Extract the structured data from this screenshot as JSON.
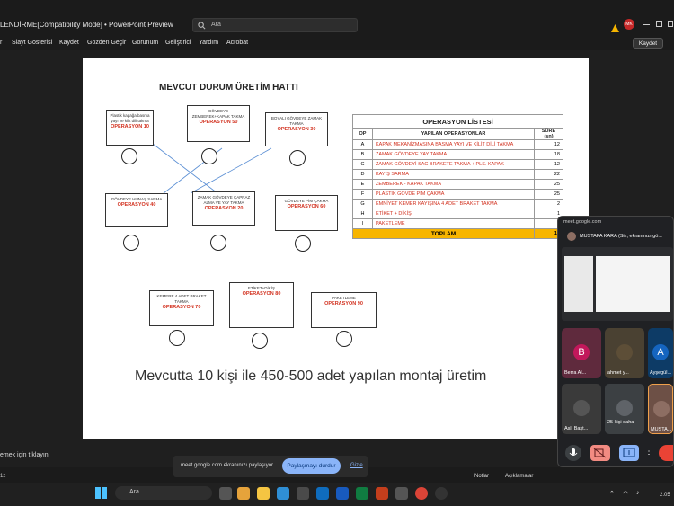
{
  "app": {
    "title": "LENDİRME[Compatibility Mode]  •  PowerPoint Preview",
    "search_placeholder": "Ara",
    "user_initials": "MK",
    "save_button": "Kaydet",
    "menu": [
      "r",
      "Slayt Gösterisi",
      "Kaydet",
      "Gözden Geçir",
      "Görünüm",
      "Geliştirici",
      "Yardım",
      "Acrobat"
    ]
  },
  "slide": {
    "title": "MEVCUT DURUM ÜRETİM HATTI",
    "stations": [
      {
        "desc": "Plastik kapağa basma yayı ve kilit dili takma",
        "op": "OPERASYON 10"
      },
      {
        "desc": "GÖVDEYE ZEMBEREK+KAPAK TAKMA",
        "op": "OPERASYON 50"
      },
      {
        "desc": "BOYALI GÖVDEYE ZAMAK TAKMA",
        "op": "OPERASYON 30"
      },
      {
        "desc": "GÖVDEYE HUNAŞ SARMA",
        "op": "OPERASYON 40"
      },
      {
        "desc": "ZAMAK GÖVDEYE ÇAPRAZ ALMA VE YAY TAKMA",
        "op": "OPERASYON 20"
      },
      {
        "desc": "GÖVDEYE PİM ÇAKMA",
        "op": "OPERASYON 60"
      },
      {
        "desc": "KEMERE 4 ADET BRAKET TAKMA",
        "op": "OPERASYON 70"
      },
      {
        "desc": "ETİKET+DİKİŞ",
        "op": "OPERASYON 80"
      },
      {
        "desc": "PAKETLEME",
        "op": "OPERASYON 90"
      }
    ],
    "table": {
      "title": "OPERASYON LİSTESİ",
      "headers": [
        "OP",
        "YAPILAN OPERASYONLAR",
        "SÜRE (sn)"
      ],
      "rows": [
        {
          "op": "A",
          "name": "KAPAK MEKANİZMASINA BASMA YAYI VE KİLİT DİLİ TAKMA",
          "sure": "12"
        },
        {
          "op": "B",
          "name": "ZAMAK GÖVDEYE YAY TAKMA",
          "sure": "18"
        },
        {
          "op": "C",
          "name": "ZAMAK GÖVDEYİ SAC BRAKETE TAKMA + PLS. KAPAK",
          "sure": "12"
        },
        {
          "op": "D",
          "name": "KAYIŞ SARMA",
          "sure": "22"
        },
        {
          "op": "E",
          "name": "ZEMBEREK - KAPAK TAKMA",
          "sure": "25"
        },
        {
          "op": "F",
          "name": "PLASTİK GÖVDE PİM ÇAKMA",
          "sure": "25"
        },
        {
          "op": "G",
          "name": "EMNİYET KEMER KAYIŞINA 4 ADET BRAKET TAKMA",
          "sure": "2"
        },
        {
          "op": "H",
          "name": "ETİKET + DİKİŞ",
          "sure": "1"
        },
        {
          "op": "I",
          "name": "PAKETLEME",
          "sure": "1"
        }
      ],
      "total_label": "TOPLAM",
      "total_value": "17"
    },
    "footer": "Mevcutta 10 kişi ile 450-500  adet yapılan montaj üretim"
  },
  "meet": {
    "url": "meet.google.com",
    "presenter": "MUSTAFA KARA (Siz, ekranınızı gö...",
    "participants": [
      {
        "initial": "B",
        "name": "Berra Al...",
        "color": "#c2185b"
      },
      {
        "initial": "",
        "name": "ahmet y...",
        "color": "#5d4e37"
      },
      {
        "initial": "A",
        "name": "Ayşegül...",
        "color": "#1565c0"
      },
      {
        "initial": "",
        "name": "Aslı Başt...",
        "color": "#3d3d3d"
      },
      {
        "initial": "",
        "name": "25 kişi daha",
        "color": "#3c4043"
      },
      {
        "initial": "",
        "name": "MUSTA...",
        "color": "#8d6e63"
      }
    ]
  },
  "status": {
    "notes_hint": "emek için tıklayın",
    "notes": "Notlar",
    "comments": "Açıklamalar",
    "zoom": "1z"
  },
  "share": {
    "text": "meet.google.com ekranınızı paylaşıyor.",
    "stop": "Paylaşmayı durdur",
    "hide": "Gizle"
  },
  "taskbar": {
    "search": "Ara",
    "time": "2.05"
  }
}
